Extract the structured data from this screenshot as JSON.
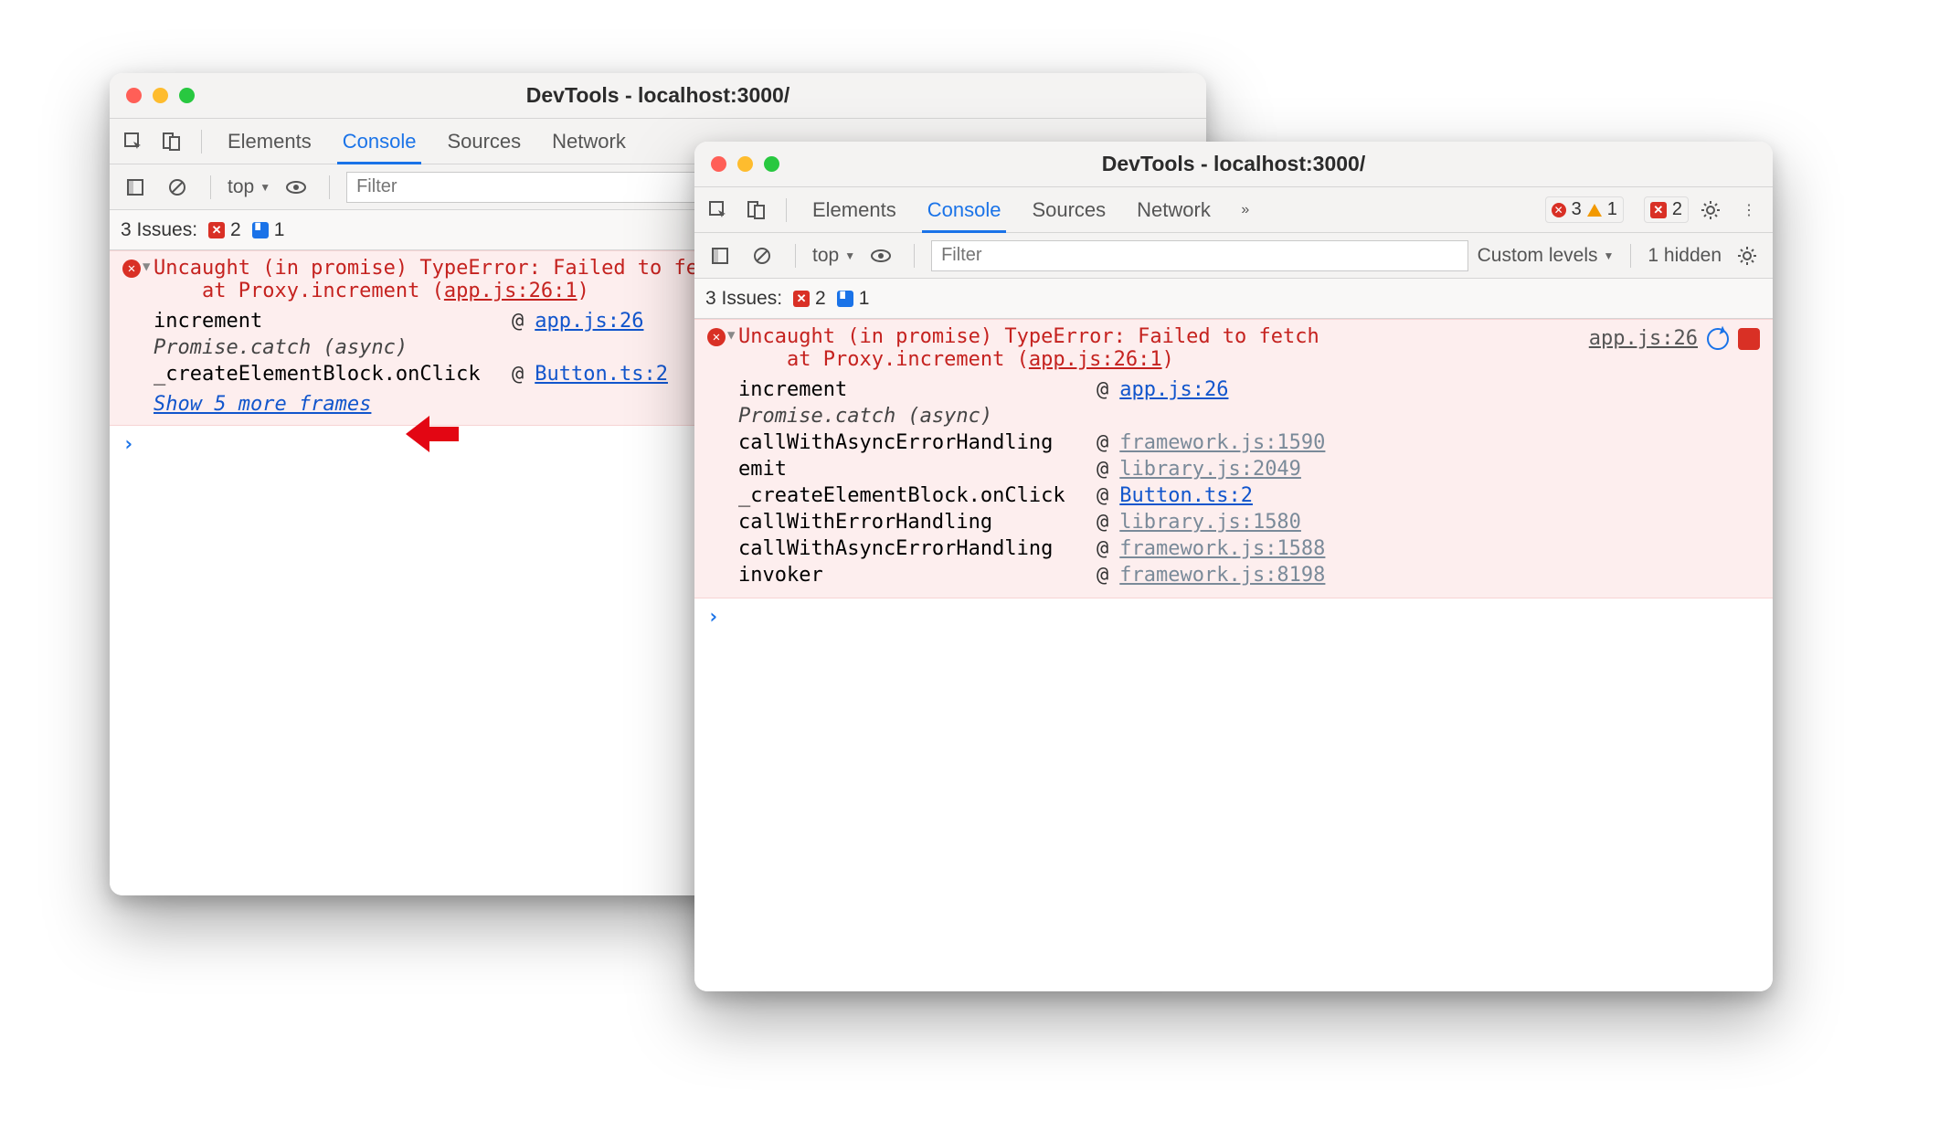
{
  "title": "DevTools - localhost:3000/",
  "tab_labels": {
    "elements": "Elements",
    "console": "Console",
    "sources": "Sources",
    "network": "Network"
  },
  "filter": {
    "placeholder": "Filter",
    "context": "top",
    "levels": "Custom levels",
    "hidden": "1 hidden"
  },
  "issues": {
    "label": "3 Issues:",
    "err": "2",
    "msg": "1"
  },
  "badges_win2": {
    "err": "3",
    "warn": "1",
    "errbox": "2"
  },
  "error": {
    "head1": "Uncaught (in promise) TypeError: Failed to fetch",
    "head2_pre": "at Proxy.increment (",
    "head2_link": "app.js:26:1",
    "head2_post": ")",
    "source_link": "app.js:26",
    "promise_catch": "Promise.catch (async)",
    "show_more": "Show 5 more frames"
  },
  "stack1": [
    {
      "fn": "increment",
      "at": "@",
      "link": "app.js:26",
      "muted": false
    },
    {
      "fn": "_createElementBlock.onClick",
      "at": "@",
      "link": "Button.ts:2",
      "muted": false
    }
  ],
  "stack2": [
    {
      "fn": "increment",
      "at": "@",
      "link": "app.js:26",
      "muted": false
    },
    {
      "fn": "callWithAsyncErrorHandling",
      "at": "@",
      "link": "framework.js:1590",
      "muted": true
    },
    {
      "fn": "emit",
      "at": "@",
      "link": "library.js:2049",
      "muted": true
    },
    {
      "fn": "_createElementBlock.onClick",
      "at": "@",
      "link": "Button.ts:2",
      "muted": false
    },
    {
      "fn": "callWithErrorHandling",
      "at": "@",
      "link": "library.js:1580",
      "muted": true
    },
    {
      "fn": "callWithAsyncErrorHandling",
      "at": "@",
      "link": "framework.js:1588",
      "muted": true
    },
    {
      "fn": "invoker",
      "at": "@",
      "link": "framework.js:8198",
      "muted": true
    }
  ]
}
